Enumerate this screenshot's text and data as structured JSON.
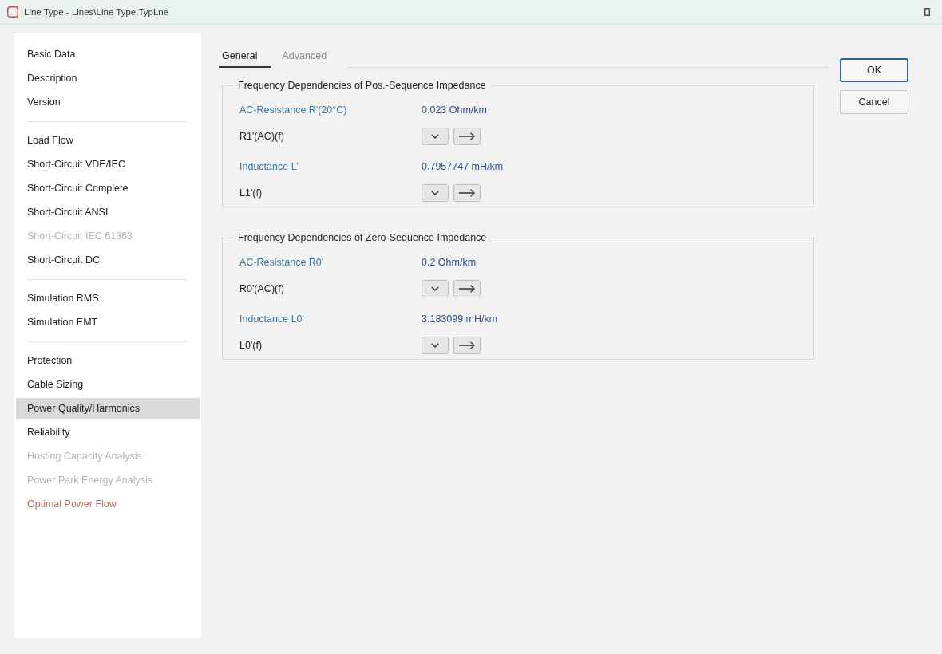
{
  "window": {
    "title": "Line Type - Lines\\Line Type.TypLne"
  },
  "sidebar": {
    "groups": [
      {
        "items": [
          {
            "label": "Basic Data",
            "selected": false,
            "kind": "normal"
          },
          {
            "label": "Description",
            "selected": false,
            "kind": "normal"
          },
          {
            "label": "Version",
            "selected": false,
            "kind": "normal"
          }
        ]
      },
      {
        "items": [
          {
            "label": "Load Flow",
            "selected": false,
            "kind": "normal"
          },
          {
            "label": "Short-Circuit VDE/IEC",
            "selected": false,
            "kind": "normal"
          },
          {
            "label": "Short-Circuit Complete",
            "selected": false,
            "kind": "normal"
          },
          {
            "label": "Short-Circuit ANSI",
            "selected": false,
            "kind": "normal"
          },
          {
            "label": "Short-Circuit IEC 61363",
            "selected": false,
            "kind": "disabled"
          },
          {
            "label": "Short-Circuit DC",
            "selected": false,
            "kind": "normal"
          }
        ]
      },
      {
        "items": [
          {
            "label": "Simulation RMS",
            "selected": false,
            "kind": "normal"
          },
          {
            "label": "Simulation EMT",
            "selected": false,
            "kind": "normal"
          }
        ]
      },
      {
        "items": [
          {
            "label": "Protection",
            "selected": false,
            "kind": "normal"
          },
          {
            "label": "Cable Sizing",
            "selected": false,
            "kind": "normal"
          },
          {
            "label": "Power Quality/Harmonics",
            "selected": true,
            "kind": "normal"
          },
          {
            "label": "Reliability",
            "selected": false,
            "kind": "normal"
          },
          {
            "label": "Hosting Capacity Analysis",
            "selected": false,
            "kind": "disabled"
          },
          {
            "label": "Power Park Energy Analysis",
            "selected": false,
            "kind": "disabled"
          },
          {
            "label": "Optimal Power Flow",
            "selected": false,
            "kind": "flagged"
          }
        ]
      }
    ]
  },
  "tabs": [
    {
      "label": "General",
      "selected": true
    },
    {
      "label": "Advanced",
      "selected": false
    }
  ],
  "groups": [
    {
      "title": "Frequency Dependencies of Pos.-Sequence Impedance",
      "rows": [
        {
          "kind": "parameter",
          "label": "AC-Resistance R'(20°C)",
          "value": "0.023 Ohm/km"
        },
        {
          "kind": "function",
          "label": "R1'(AC)(f)"
        },
        {
          "kind": "parameter",
          "label": "Inductance L'",
          "value": "0.7957747 mH/km"
        },
        {
          "kind": "function",
          "label": "L1'(f)"
        }
      ]
    },
    {
      "title": "Frequency Dependencies of Zero-Sequence Impedance",
      "rows": [
        {
          "kind": "parameter",
          "label": "AC-Resistance R0'",
          "value": "0.2 Ohm/km"
        },
        {
          "kind": "function",
          "label": "R0'(AC)(f)"
        },
        {
          "kind": "parameter",
          "label": "Inductance L0'",
          "value": "3.183099 mH/km"
        },
        {
          "kind": "function",
          "label": "L0'(f)"
        }
      ]
    }
  ],
  "buttons": [
    {
      "label": "OK",
      "default": true
    },
    {
      "label": "Cancel",
      "default": false
    }
  ]
}
